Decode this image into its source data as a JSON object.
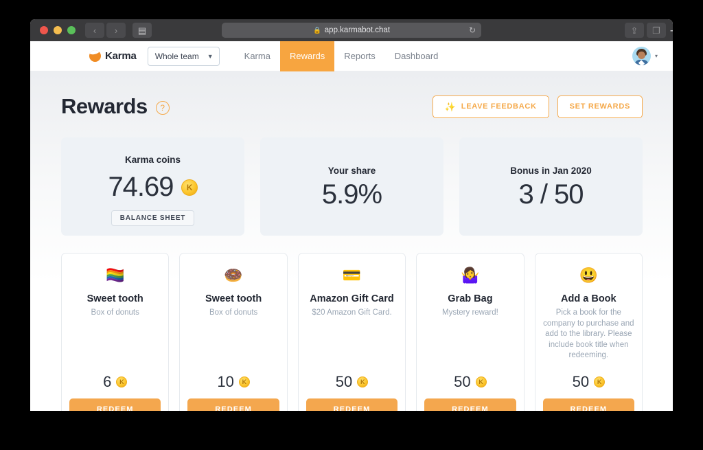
{
  "browser": {
    "url": "app.karmabot.chat",
    "lock_icon": "lock-icon",
    "reload_icon": "reload-icon",
    "back_icon": "‹",
    "forward_icon": "›",
    "sidebar_icon": "▤",
    "share_icon": "⇪",
    "tabs_icon": "❐",
    "new_tab_icon": "+"
  },
  "app_header": {
    "brand_name": "Karma",
    "team_selector": {
      "value": "Whole team",
      "caret": "❯"
    },
    "nav_tabs": [
      {
        "label": "Karma",
        "active": false
      },
      {
        "label": "Rewards",
        "active": true
      },
      {
        "label": "Reports",
        "active": false
      },
      {
        "label": "Dashboard",
        "active": false
      }
    ],
    "avatar_caret": "▾"
  },
  "page": {
    "title": "Rewards",
    "help_glyph": "?",
    "actions": [
      {
        "label": "LEAVE FEEDBACK",
        "icon": "✨"
      },
      {
        "label": "SET REWARDS",
        "icon": ""
      }
    ]
  },
  "stats": [
    {
      "label": "Karma coins",
      "value": "74.69",
      "coin_glyph": "K",
      "has_coin": true,
      "button": "BALANCE SHEET"
    },
    {
      "label": "Your share",
      "value": "5.9%",
      "has_coin": false,
      "button": ""
    },
    {
      "label": "Bonus in Jan 2020",
      "value": "3 / 50",
      "has_coin": false,
      "button": ""
    }
  ],
  "rewards": [
    {
      "emoji": "🏳️‍🌈",
      "emoji_name": "rainbow-flag-icon",
      "title": "Sweet tooth",
      "desc": "Box of donuts",
      "price": "6",
      "coin_glyph": "K",
      "redeem_label": "REDEEM"
    },
    {
      "emoji": "🍩",
      "emoji_name": "donut-icon",
      "title": "Sweet tooth",
      "desc": "Box of donuts",
      "price": "10",
      "coin_glyph": "K",
      "redeem_label": "REDEEM"
    },
    {
      "emoji": "💳",
      "emoji_name": "credit-card-icon",
      "title": "Amazon Gift Card",
      "desc": "$20 Amazon Gift Card.",
      "price": "50",
      "coin_glyph": "K",
      "redeem_label": "REDEEM"
    },
    {
      "emoji": "🤷‍♀️",
      "emoji_name": "shrug-icon",
      "title": "Grab Bag",
      "desc": "Mystery reward!",
      "price": "50",
      "coin_glyph": "K",
      "redeem_label": "REDEEM"
    },
    {
      "emoji": "😃",
      "emoji_name": "grinning-face-icon",
      "title": "Add a Book",
      "desc": "Pick a book for the company to purchase and add to the library. Please include book title when redeeming.",
      "price": "50",
      "coin_glyph": "K",
      "redeem_label": "REDEEM"
    }
  ],
  "colors": {
    "accent": "#f4a74e",
    "active_tab": "#f7a540",
    "text_dark": "#232833",
    "text_muted": "#9aa6b4",
    "stat_card_bg": "#eef2f6",
    "coin": "#fcc62d"
  }
}
